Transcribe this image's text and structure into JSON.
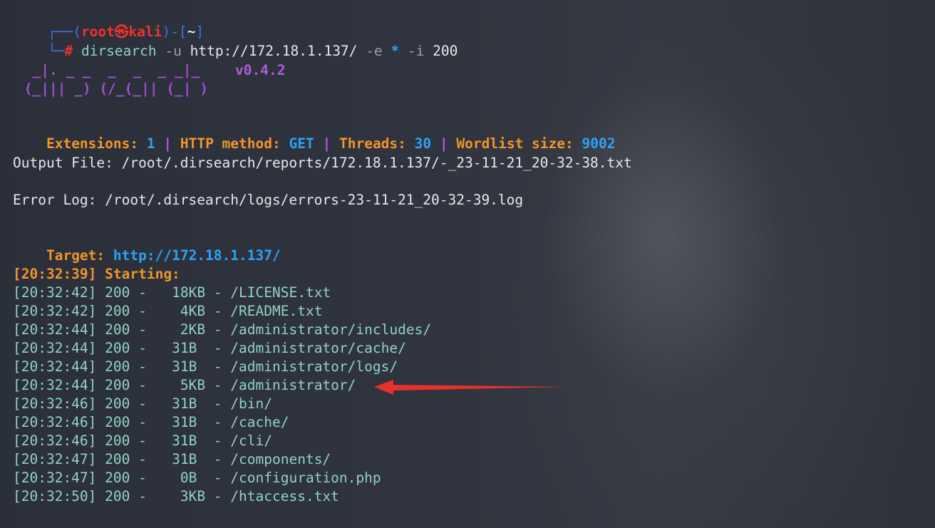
{
  "prompt": {
    "bracket_open": "┌──(",
    "user": "root",
    "at": "㉿",
    "host": "kali",
    "sep": ")-[",
    "dir": "~",
    "bracket_close": "]",
    "line2": "└─",
    "hash": "#",
    "command": "dirsearch",
    "args": [
      {
        "text": "-u",
        "kind": "flag"
      },
      {
        "text": "http://172.18.1.137/",
        "kind": "plain"
      },
      {
        "text": "-e",
        "kind": "flag"
      },
      {
        "text": "*",
        "kind": "star"
      },
      {
        "text": "-i",
        "kind": "flag"
      },
      {
        "text": "200",
        "kind": "plain"
      }
    ]
  },
  "banner": {
    "ascii_line1": "  _|. _ _  _  _  _ _|_",
    "ascii_line2": " (_||| _) (/_(_|| (_| )",
    "version": "v0.4.2"
  },
  "config": {
    "ext_label": "Extensions:",
    "ext_value": "1",
    "method_label": "HTTP method:",
    "method_value": "GET",
    "threads_label": "Threads:",
    "threads_value": "30",
    "wordlist_label": "Wordlist size:",
    "wordlist_value": "9002",
    "pipe": "|"
  },
  "output_file": "Output File: /root/.dirsearch/reports/172.18.1.137/-_23-11-21_20-32-38.txt",
  "error_log": "Error Log: /root/.dirsearch/logs/errors-23-11-21_20-32-39.log",
  "target": {
    "label": "Target:",
    "url": "http://172.18.1.137/"
  },
  "starting": "[20:32:39] Starting:",
  "results": [
    {
      "time": "[20:32:42]",
      "status": "200",
      "size": "18KB",
      "path": "/LICENSE.txt"
    },
    {
      "time": "[20:32:42]",
      "status": "200",
      "size": " 4KB",
      "path": "/README.txt"
    },
    {
      "time": "[20:32:44]",
      "status": "200",
      "size": " 2KB",
      "path": "/administrator/includes/"
    },
    {
      "time": "[20:32:44]",
      "status": "200",
      "size": "31B ",
      "path": "/administrator/cache/"
    },
    {
      "time": "[20:32:44]",
      "status": "200",
      "size": "31B ",
      "path": "/administrator/logs/"
    },
    {
      "time": "[20:32:44]",
      "status": "200",
      "size": " 5KB",
      "path": "/administrator/"
    },
    {
      "time": "[20:32:46]",
      "status": "200",
      "size": "31B ",
      "path": "/bin/"
    },
    {
      "time": "[20:32:46]",
      "status": "200",
      "size": "31B ",
      "path": "/cache/"
    },
    {
      "time": "[20:32:46]",
      "status": "200",
      "size": "31B ",
      "path": "/cli/"
    },
    {
      "time": "[20:32:47]",
      "status": "200",
      "size": "31B ",
      "path": "/components/"
    },
    {
      "time": "[20:32:47]",
      "status": "200",
      "size": " 0B ",
      "path": "/configuration.php"
    },
    {
      "time": "[20:32:50]",
      "status": "200",
      "size": " 3KB",
      "path": "/htaccess.txt"
    }
  ],
  "annotation_color": "#e8302c"
}
